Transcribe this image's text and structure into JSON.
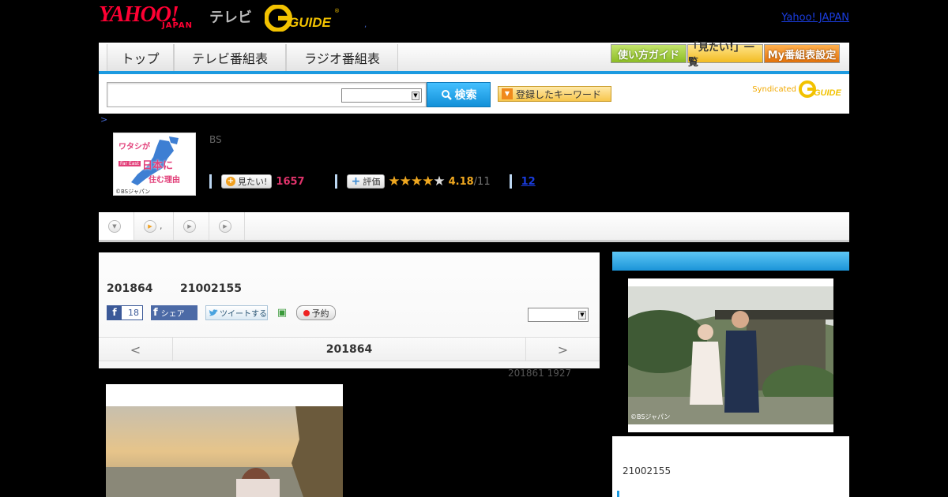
{
  "header": {
    "logo_yahoo": "YAHOO!",
    "logo_japan": "JAPAN",
    "logo_tv": "テレビ",
    "logo_gguide": "G GUIDE",
    "yahoo_japan_link": "Yahoo! JAPAN"
  },
  "nav": {
    "tabs": [
      {
        "label": "トップ"
      },
      {
        "label": "テレビ番組表"
      },
      {
        "label": "ラジオ番組表"
      }
    ],
    "buttons": {
      "guide": "使い方ガイド",
      "mitai_list": "「見たい!」一覧",
      "my_schedule": "My番組表設定"
    }
  },
  "search": {
    "query": "",
    "category_selected": "",
    "button_label": "検索",
    "registered_keywords": "登録したキーワード",
    "syndicated_label": "Syndicated"
  },
  "breadcrumb": ">",
  "program": {
    "thumb_title_1": "ワタシが",
    "thumb_title_2": "日本に",
    "thumb_title_3": "住む理由",
    "thumb_tag": "Far East",
    "thumb_copyright": "©BSジャパン",
    "channel": "BS",
    "mitai_label": "見たい!",
    "mitai_count": "1657",
    "review_label": "評価",
    "rating": "4.18",
    "rating_max": "/11",
    "reviews_link": "12"
  },
  "tabs_strip": {
    "t2_label": ","
  },
  "episode": {
    "date": "201864",
    "time": "21002155",
    "fb_count": "18",
    "fb_share": "シェア",
    "tweet": "ツイートする",
    "reserve": "予約",
    "select_value": "",
    "pager_prev": "<",
    "pager_current": "201864",
    "pager_next": ">",
    "updated": "201861  1927"
  },
  "right_panel": {
    "photo_copyright": "©BSジャパン",
    "date": "21002155"
  },
  "colors": {
    "accent_blue": "#1c9ae0",
    "brand_red": "#ff0033",
    "gguide_yellow": "#f2c200",
    "pink_count": "#e0336b",
    "star": "#f0a820"
  }
}
